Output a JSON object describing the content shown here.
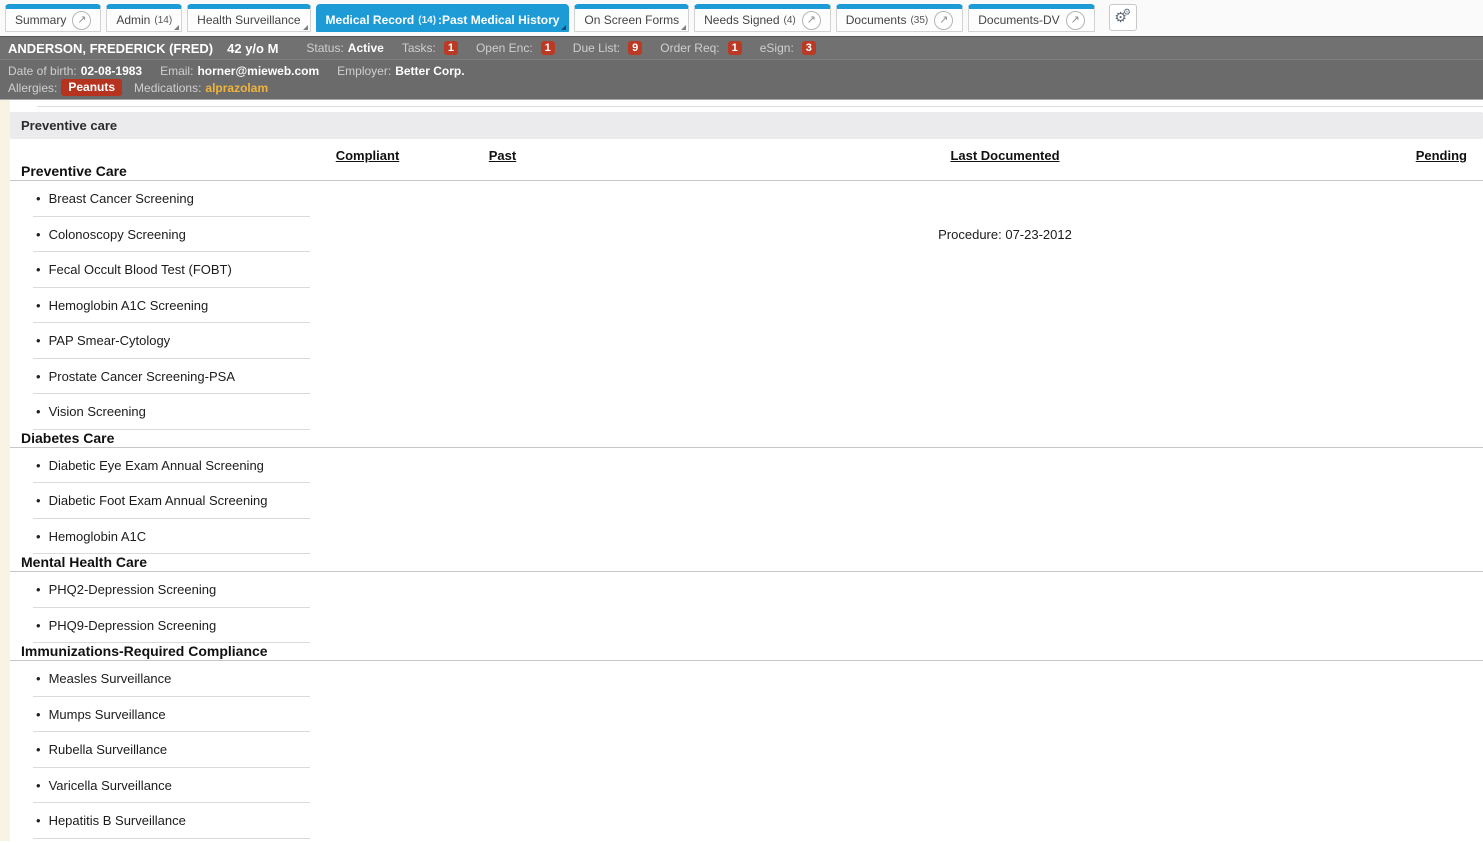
{
  "colors": {
    "accent_blue": "#1d9bd7",
    "badge_red": "#ba3a26",
    "allergy_red": "#b5331f",
    "medication_gold": "#f0b43c",
    "header_gray": "#6e6e6e",
    "panel_bar_gray": "#ebebee",
    "edge_strip_cream": "#f8f3e3"
  },
  "icons": {
    "external_link": "↗",
    "gears": "⚙",
    "bullet": "•"
  },
  "tabs": [
    {
      "label": "Summary"
    },
    {
      "label": "Admin",
      "count": "(14)"
    },
    {
      "label": "Health Surveillance"
    },
    {
      "label": "Medical Record",
      "count": "(14)",
      "suffix": ":Past Medical History"
    },
    {
      "label": "On Screen Forms"
    },
    {
      "label": "Needs Signed",
      "count": "(4)"
    },
    {
      "label": "Documents",
      "count": "(35)"
    },
    {
      "label": "Documents-DV"
    }
  ],
  "patient": {
    "name": "ANDERSON, FREDERICK (FRED)",
    "age_sex": "42 y/o M",
    "status_label": "Status:",
    "status": "Active",
    "tasks_label": "Tasks:",
    "tasks": "1",
    "open_enc_label": "Open Enc:",
    "open_enc": "1",
    "due_list_label": "Due List:",
    "due_list": "9",
    "order_req_label": "Order Req:",
    "order_req": "1",
    "esign_label": "eSign:",
    "esign": "3",
    "dob_label": "Date of birth:",
    "dob": "02-08-1983",
    "email_label": "Email:",
    "email": "horner@mieweb.com",
    "employer_label": "Employer:",
    "employer": "Better Corp.",
    "allergies_label": "Allergies:",
    "allergy": "Peanuts",
    "medications_label": "Medications:",
    "medication": "alprazolam"
  },
  "panel": {
    "title": "Preventive care"
  },
  "care_table": {
    "headers": {
      "compliant": "Compliant",
      "past": "Past",
      "last_documented": "Last Documented",
      "pending": "Pending"
    },
    "sections": [
      {
        "title": "Preventive Care",
        "items": [
          {
            "name": "Breast Cancer Screening"
          },
          {
            "name": "Colonoscopy Screening",
            "last_documented": "Procedure: 07-23-2012"
          },
          {
            "name": "Fecal Occult Blood Test (FOBT)"
          },
          {
            "name": "Hemoglobin A1C Screening"
          },
          {
            "name": "PAP Smear-Cytology"
          },
          {
            "name": "Prostate Cancer Screening-PSA"
          },
          {
            "name": "Vision Screening"
          }
        ]
      },
      {
        "title": "Diabetes Care",
        "items": [
          {
            "name": "Diabetic Eye Exam Annual Screening"
          },
          {
            "name": "Diabetic Foot Exam Annual Screening"
          },
          {
            "name": "Hemoglobin A1C"
          }
        ]
      },
      {
        "title": "Mental Health Care",
        "items": [
          {
            "name": "PHQ2-Depression Screening"
          },
          {
            "name": "PHQ9-Depression Screening"
          }
        ]
      },
      {
        "title": "Immunizations-Required Compliance",
        "items": [
          {
            "name": "Measles Surveillance"
          },
          {
            "name": "Mumps Surveillance"
          },
          {
            "name": "Rubella Surveillance"
          },
          {
            "name": "Varicella Surveillance"
          },
          {
            "name": "Hepatitis B Surveillance"
          }
        ]
      }
    ]
  }
}
